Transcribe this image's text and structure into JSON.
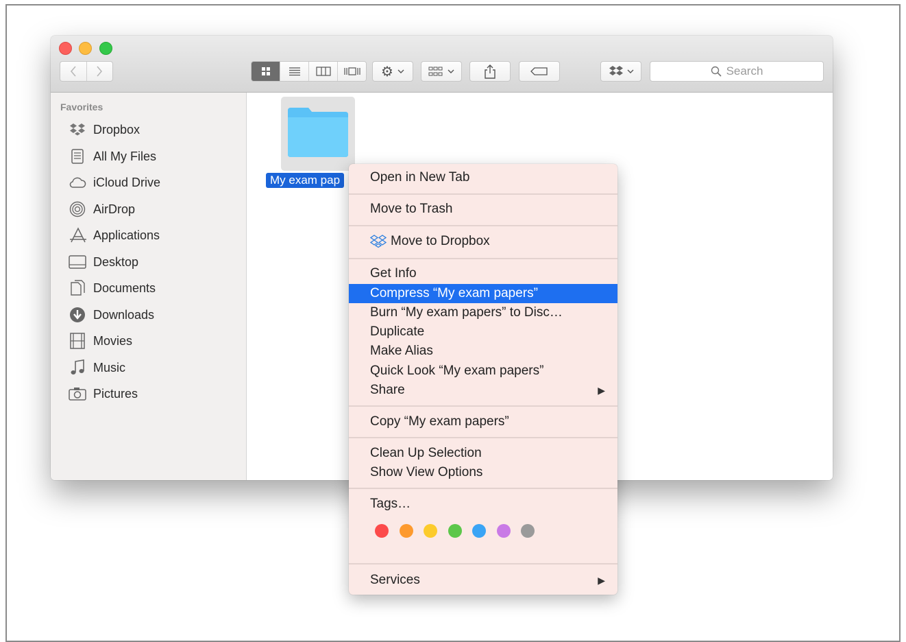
{
  "sidebar": {
    "heading": "Favorites",
    "items": [
      {
        "label": "Dropbox",
        "icon": "dropbox-icon"
      },
      {
        "label": "All My Files",
        "icon": "all-files-icon"
      },
      {
        "label": "iCloud Drive",
        "icon": "cloud-icon"
      },
      {
        "label": "AirDrop",
        "icon": "airdrop-icon"
      },
      {
        "label": "Applications",
        "icon": "applications-icon"
      },
      {
        "label": "Desktop",
        "icon": "desktop-icon"
      },
      {
        "label": "Documents",
        "icon": "documents-icon"
      },
      {
        "label": "Downloads",
        "icon": "downloads-icon"
      },
      {
        "label": "Movies",
        "icon": "movies-icon"
      },
      {
        "label": "Music",
        "icon": "music-icon"
      },
      {
        "label": "Pictures",
        "icon": "pictures-icon"
      }
    ]
  },
  "toolbar": {
    "search_placeholder": "Search"
  },
  "content": {
    "folder_label": "My exam pap"
  },
  "menu": {
    "open_new_tab": "Open in New Tab",
    "move_to_trash": "Move to Trash",
    "move_to_dropbox": "Move to Dropbox",
    "get_info": "Get Info",
    "compress": "Compress “My exam papers”",
    "burn": "Burn “My exam papers” to Disc…",
    "duplicate": "Duplicate",
    "make_alias": "Make Alias",
    "quick_look": "Quick Look “My exam papers”",
    "share": "Share",
    "copy": "Copy “My exam papers”",
    "clean_up": "Clean Up Selection",
    "show_view_options": "Show View Options",
    "tags": "Tags…",
    "services": "Services",
    "tag_colors": [
      "#fc4b4b",
      "#fd9a2e",
      "#fccb2c",
      "#5cc74a",
      "#3aa4f5",
      "#c97ae6",
      "#9a9a9a"
    ]
  },
  "colors": {
    "selection_blue": "#1e6ff0",
    "folder_blue": "#5bc2f7"
  }
}
